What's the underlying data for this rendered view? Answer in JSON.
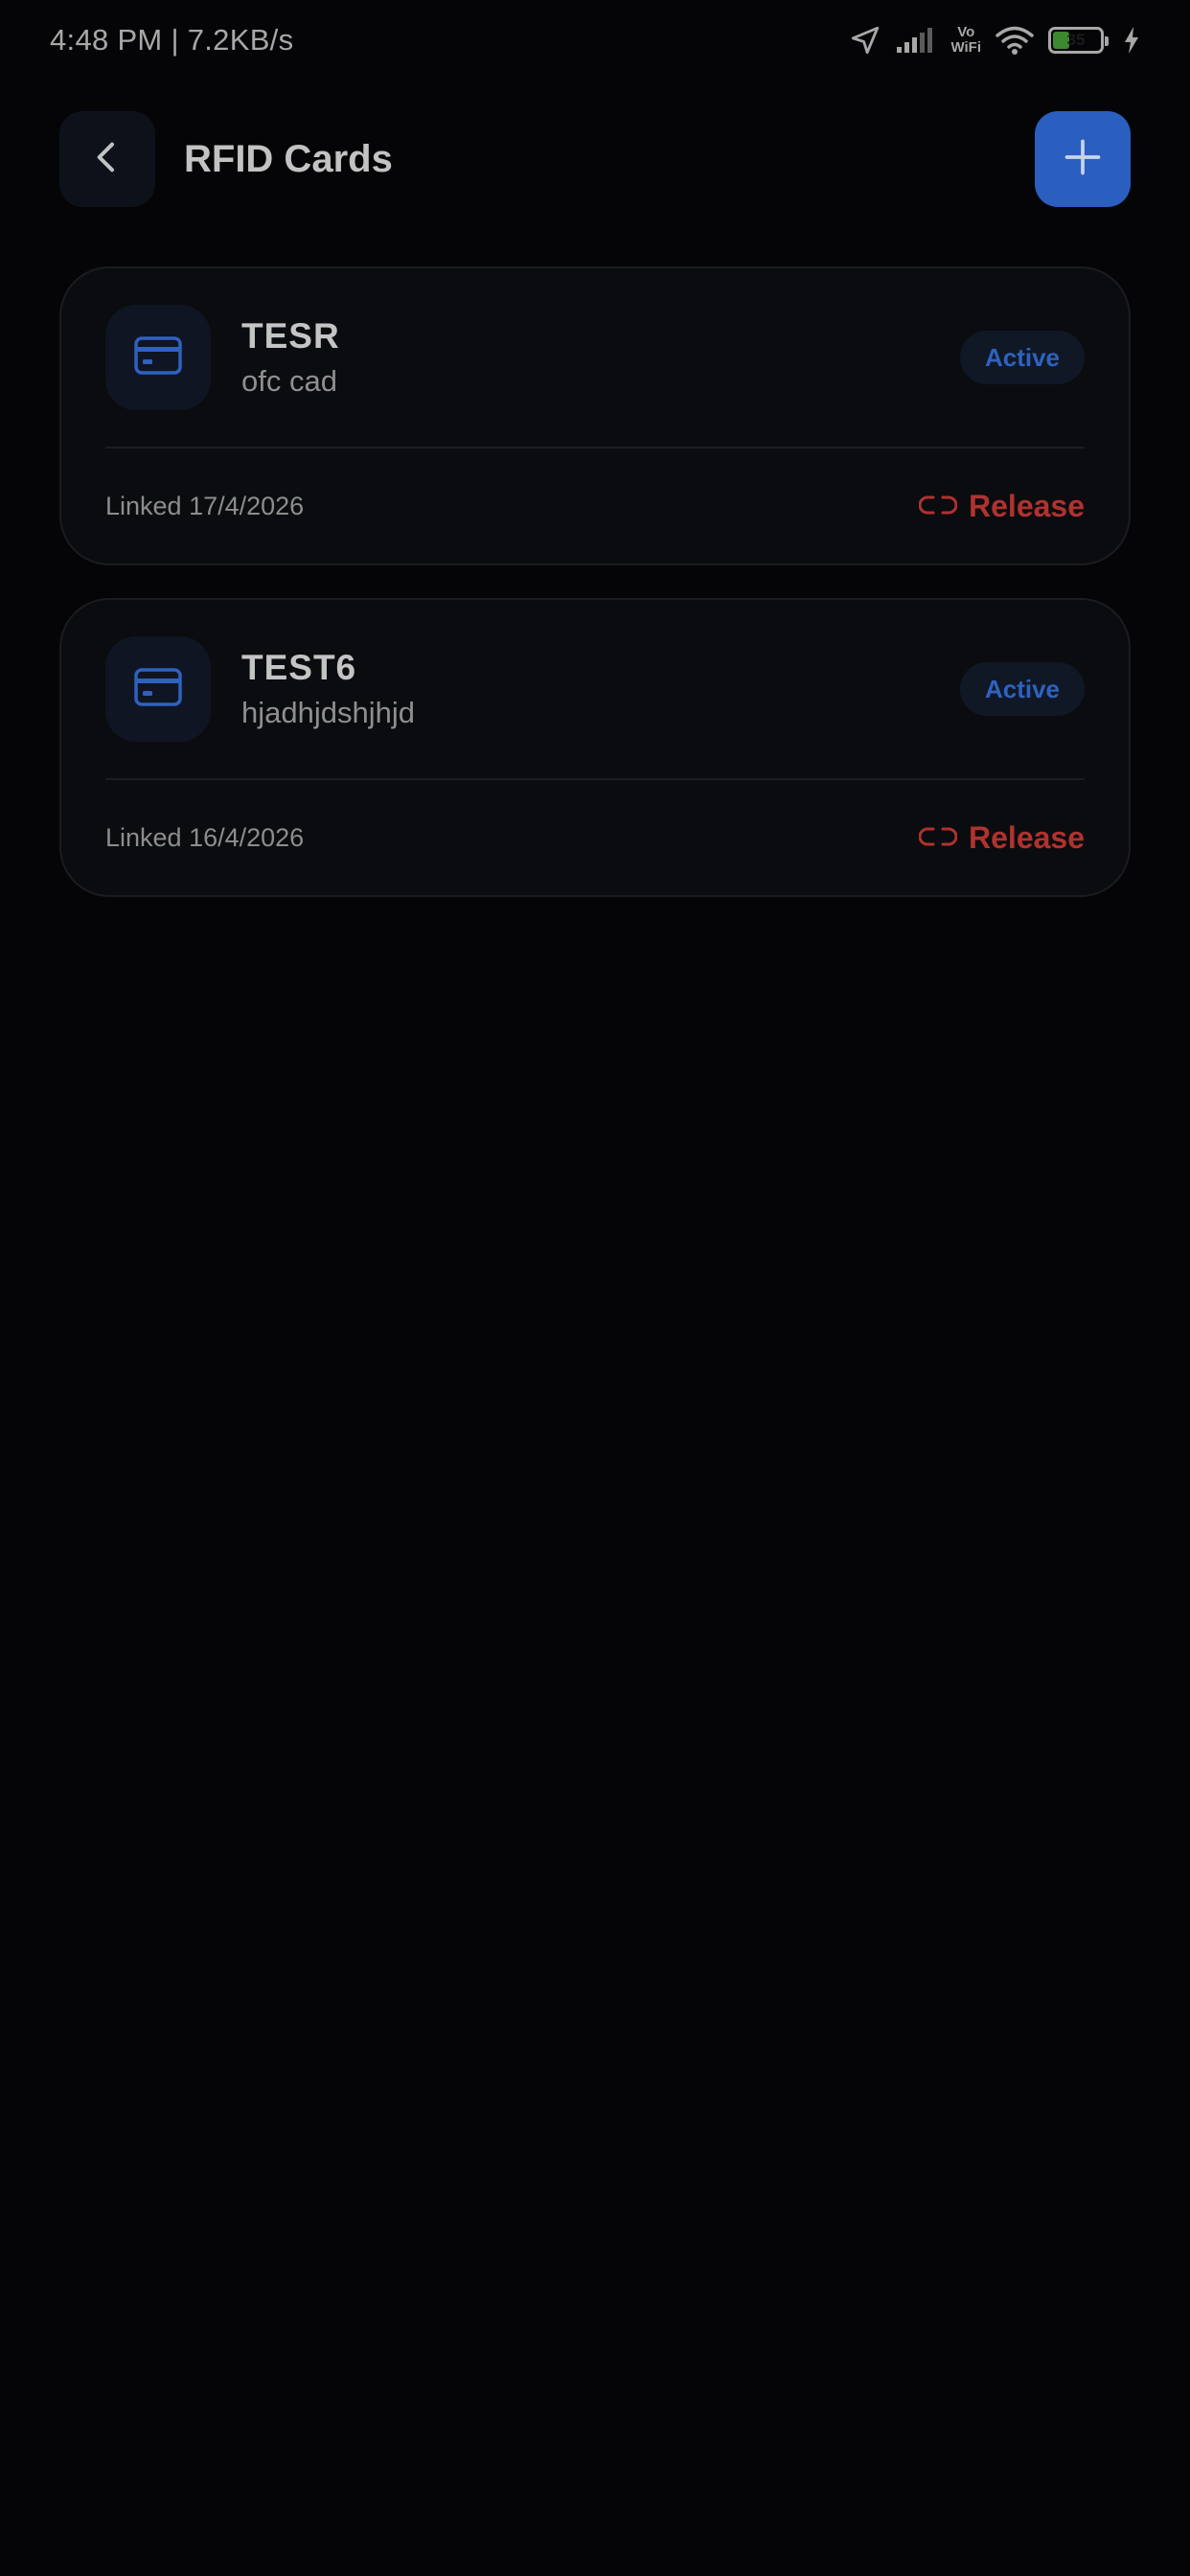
{
  "status_bar": {
    "time_speed": "4:48 PM | 7.2KB/s",
    "vowifi_top": "Vo",
    "vowifi_bottom": "WiFi",
    "battery_level": "35",
    "battery_fraction": 0.35,
    "icons": [
      "location-arrow-icon",
      "signal-icon",
      "wifi-icon",
      "battery-icon",
      "charging-icon"
    ]
  },
  "header": {
    "title": "RFID Cards",
    "back_icon": "chevron-left-icon",
    "add_icon": "plus-icon"
  },
  "colors": {
    "accent": "#2a5fc0",
    "danger": "#b0322e",
    "background": "#050507",
    "card": "#0b0c0f"
  },
  "cards": [
    {
      "name": "TESR",
      "description": "ofc cad",
      "status": "Active",
      "linked": "Linked 17/4/2026",
      "release_label": "Release"
    },
    {
      "name": "TEST6",
      "description": "hjadhjdshjhjd",
      "status": "Active",
      "linked": "Linked 16/4/2026",
      "release_label": "Release"
    }
  ]
}
